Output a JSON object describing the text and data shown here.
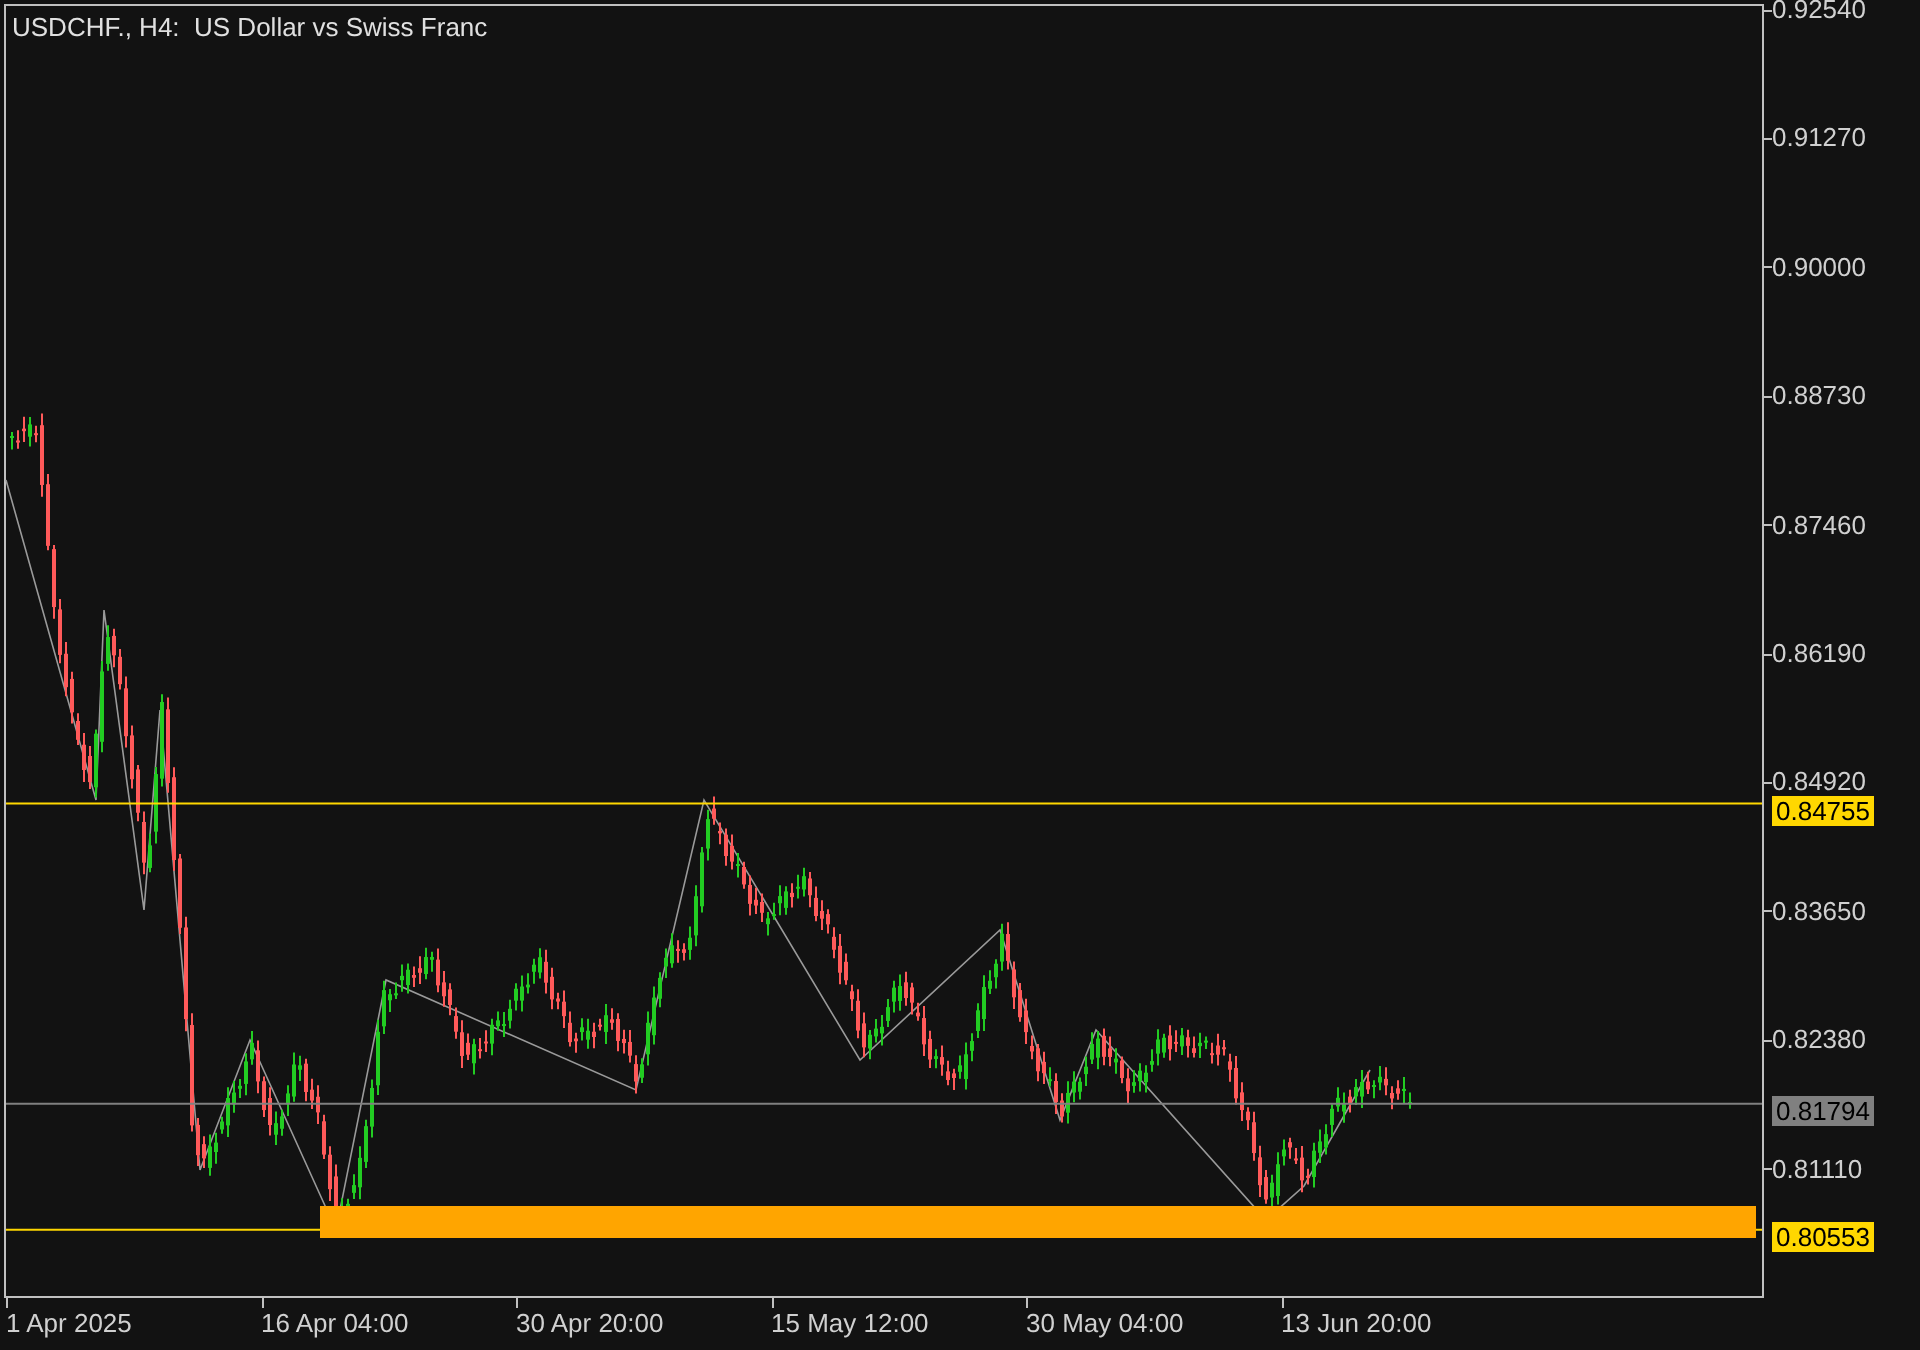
{
  "chart": {
    "title": "USDCHF., H4:  US Dollar vs Swiss Franc"
  },
  "price_axis": {
    "labels": [
      "0.92540",
      "0.91270",
      "0.90000",
      "0.88730",
      "0.87460",
      "0.86190",
      "0.84920",
      "0.83650",
      "0.82380",
      "0.81110"
    ]
  },
  "price_levels": [
    {
      "text": "0.84755",
      "color": "#ffd700"
    },
    {
      "text": "0.81794",
      "color": "#808080"
    },
    {
      "text": "0.80553",
      "color": "#ffd700"
    }
  ],
  "time_axis": {
    "labels": [
      "1 Apr 2025",
      "16 Apr 04:00",
      "30 Apr 20:00",
      "15 May 12:00",
      "30 May 04:00",
      "13 Jun 20:00"
    ]
  }
}
